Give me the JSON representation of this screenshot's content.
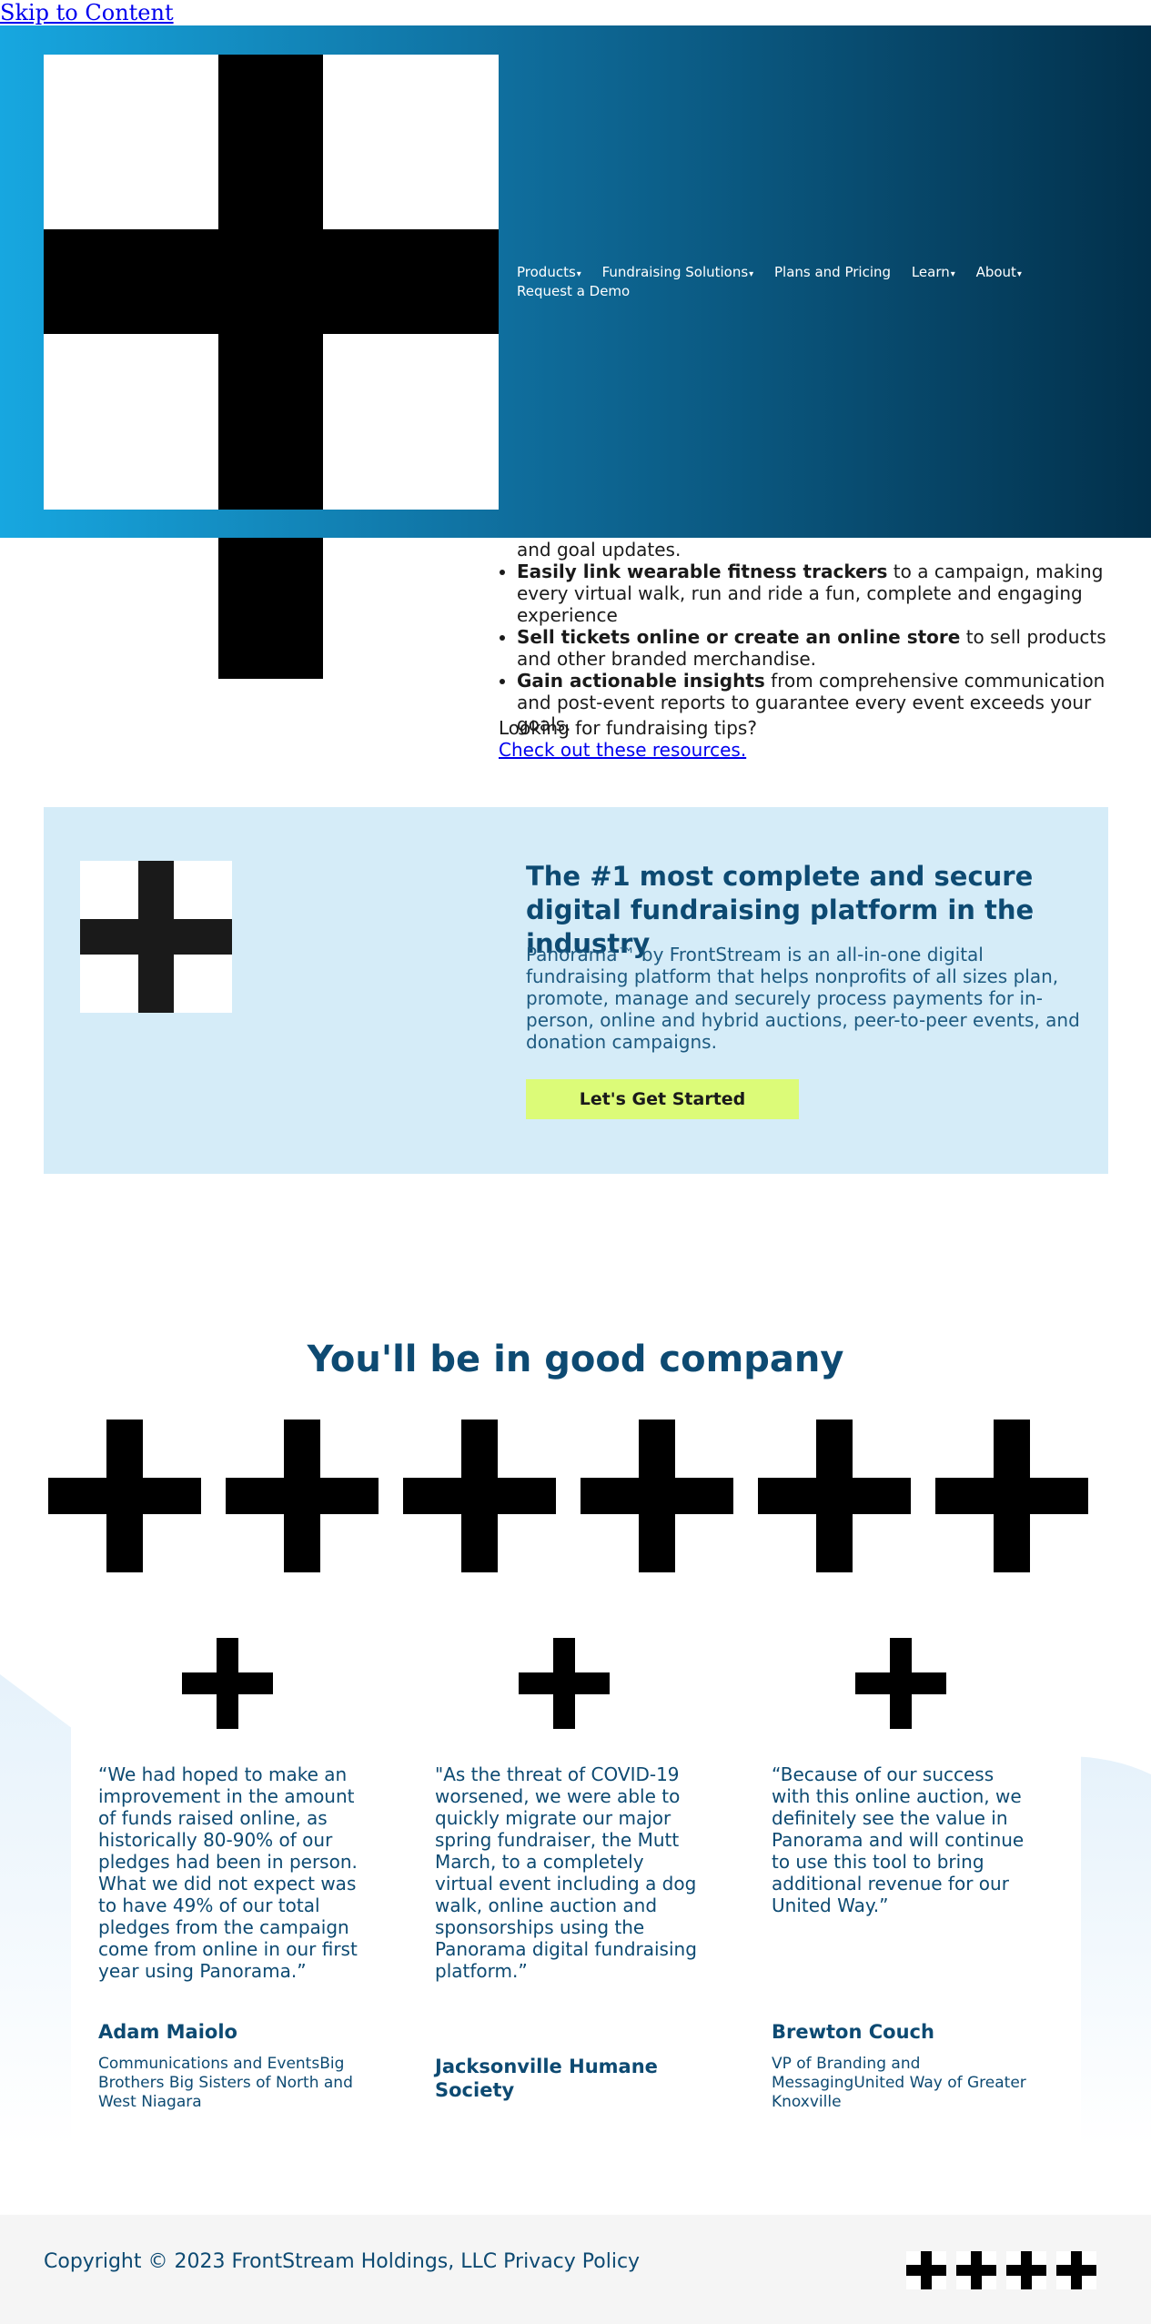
{
  "skip_link": "Skip to Content",
  "nav": {
    "items": [
      {
        "label": "Products",
        "has_dropdown": true
      },
      {
        "label": "Fundraising Solutions",
        "has_dropdown": true
      },
      {
        "label": "Plans and Pricing",
        "has_dropdown": false
      },
      {
        "label": "Learn",
        "has_dropdown": true
      },
      {
        "label": "About",
        "has_dropdown": true
      },
      {
        "label": "Request a Demo",
        "has_dropdown": false
      }
    ],
    "caret": "▾"
  },
  "features": {
    "partial_line": "and goal updates.",
    "items": [
      {
        "bold": "Easily link wearable fitness trackers",
        "text": " to a campaign, making every virtual walk, run and ride a fun, complete and engaging experience"
      },
      {
        "bold": "Sell tickets online or create an online store",
        "text": " to sell products and other branded merchandise."
      },
      {
        "bold": "Gain actionable insights",
        "text": " from comprehensive communication and post-event reports to guarantee every event exceeds your goals."
      }
    ]
  },
  "tips": {
    "text": "Looking for fundraising tips?",
    "link": "Check out these resources."
  },
  "cta": {
    "title": "The #1 most complete and secure digital fundraising platform in the industry",
    "text": "Panorama™ by FrontStream is an all-in-one digital fundraising platform that helps nonprofits of all sizes plan, promote, manage and securely process payments for in-person, online and hybrid auctions, peer-to-peer events, and donation campaigns.",
    "button": "Let's Get Started"
  },
  "company": {
    "title": "You'll be in good company",
    "logo_count": 6
  },
  "testimonials": [
    {
      "quote": "“We had hoped to make an improvement in the amount of funds raised online, as historically 80-90% of our pledges had been in person. What we did not expect was to have 49% of our total pledges from the campaign come from online in our first year using Panorama.”",
      "name": "Adam Maiolo",
      "role": "Communications and EventsBig Brothers Big Sisters of North and West Niagara"
    },
    {
      "quote": "\"As the threat of COVID-19 worsened, we were able to quickly migrate our major spring fundraiser, the Mutt March, to a completely virtual event including a dog walk, online auction and sponsorships using the Panorama digital fundraising platform.”",
      "name": "Jacksonville Humane Society",
      "role": ""
    },
    {
      "quote": "“Because of our success with this online auction, we definitely see the value in Panorama and will continue to use this tool to bring additional revenue for our United Way.”",
      "name": "Brewton Couch",
      "role": "VP of Branding and MessagingUnited Way of Greater Knoxville"
    }
  ],
  "footer": {
    "copyright": "Copyright © 2023 FrontStream Holdings, LLC",
    "privacy": "Privacy Policy",
    "social_icons": [
      "social-icon-1",
      "social-icon-2",
      "social-icon-3",
      "social-icon-4"
    ]
  },
  "colors": {
    "header_gradient_start": "#17a7e0",
    "header_gradient_end": "#02304b",
    "brand_navy": "#0d4a72",
    "cta_background": "#d5ecf8",
    "cta_button": "#dcfb78",
    "footer_background": "#f5f5f5"
  }
}
